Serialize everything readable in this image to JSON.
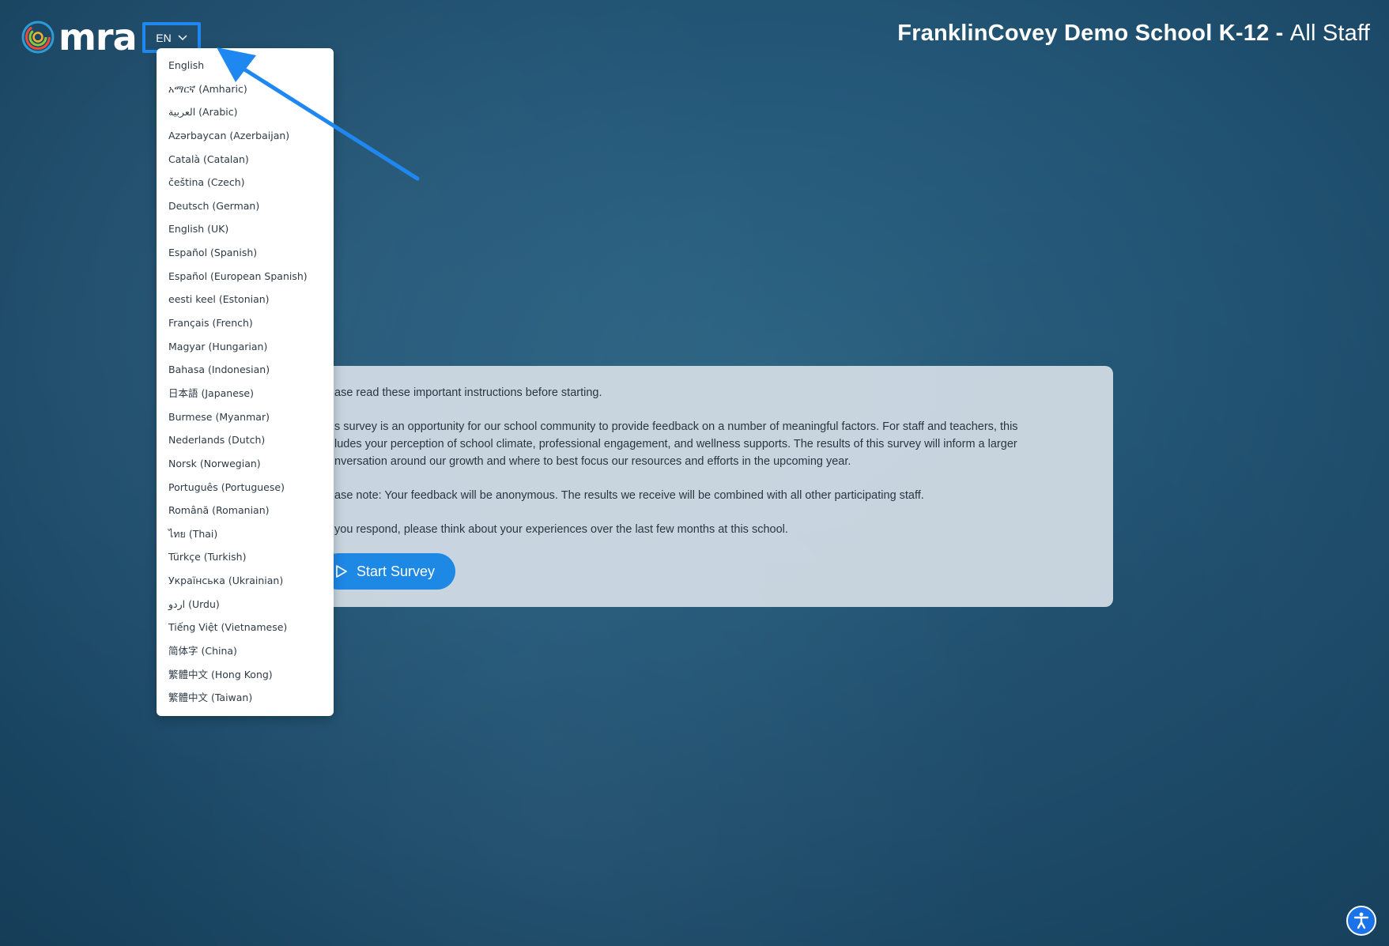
{
  "brand": {
    "logo_text": "mra",
    "logo_icon": "mra-ring-logo"
  },
  "language": {
    "current": "EN",
    "options": [
      "English",
      "አማርኛ (Amharic)",
      "العربية (Arabic)",
      "Azərbaycan (Azerbaijan)",
      "Català (Catalan)",
      "čeština (Czech)",
      "Deutsch (German)",
      "English (UK)",
      "Español (Spanish)",
      "Español (European Spanish)",
      "eesti keel (Estonian)",
      "Français (French)",
      "Magyar (Hungarian)",
      "Bahasa (Indonesian)",
      "日本語 (Japanese)",
      "Burmese (Myanmar)",
      "Nederlands (Dutch)",
      "Norsk (Norwegian)",
      "Português (Portuguese)",
      "Română (Romanian)",
      "ไทย (Thai)",
      "Türkçe (Turkish)",
      "Українська (Ukrainian)",
      "اردو (Urdu)",
      "Tiếng Việt (Vietnamese)",
      "简体字 (China)",
      "繁體中文 (Hong Kong)",
      "繁體中文 (Taiwan)"
    ]
  },
  "header": {
    "school": "FranklinCovey Demo School K-12",
    "separator": " - ",
    "audience": "All Staff"
  },
  "instructions": {
    "p1": "ase read these important instructions before starting.",
    "p2_l1": "s survey is an opportunity for our school community to provide feedback on a number of meaningful factors. For staff and teachers, this",
    "p2_l2": "ludes your perception of school climate, professional engagement, and wellness supports. The results of this survey will inform a larger",
    "p2_l3": "nversation around our growth and where to best focus our resources and efforts in the upcoming year.",
    "p3": "ase note: Your feedback will be anonymous. The results we receive will be combined with all other participating staff.",
    "p4": "you respond, please think about your experiences over the last few months at this school.",
    "start_label": "Start Survey",
    "start_icon": "play-icon"
  },
  "accessibility": {
    "icon": "accessibility-icon"
  },
  "colors": {
    "background": "#25597a",
    "accent": "#1e88e5",
    "highlight": "#1e88f0",
    "card": "#d4dee6"
  }
}
